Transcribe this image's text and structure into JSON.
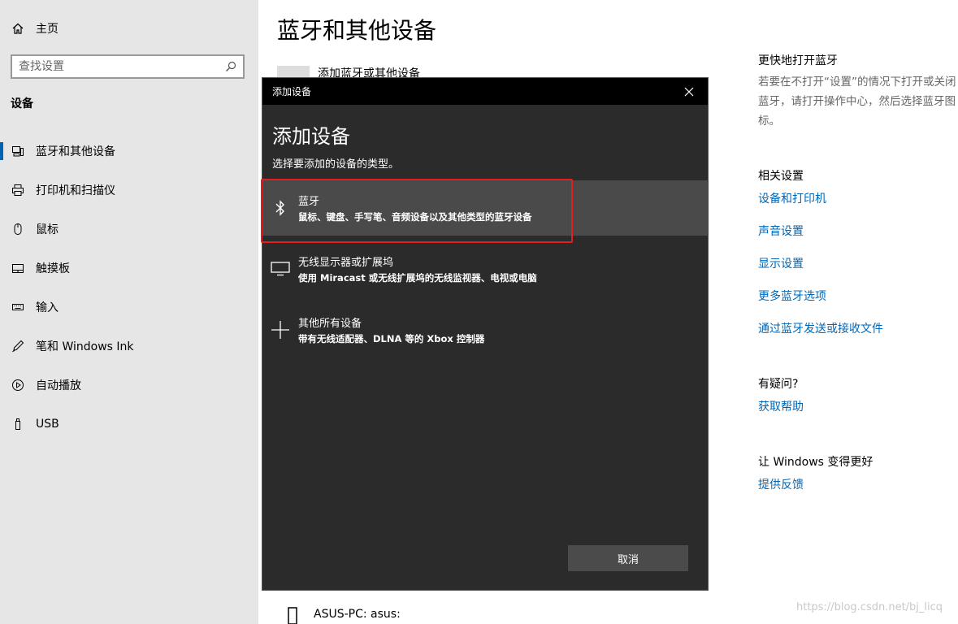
{
  "sidebar": {
    "home_label": "主页",
    "search_placeholder": "查找设置",
    "section_label": "设备",
    "items": [
      {
        "label": "蓝牙和其他设备",
        "icon": "bluetooth-devices-icon"
      },
      {
        "label": "打印机和扫描仪",
        "icon": "printer-icon"
      },
      {
        "label": "鼠标",
        "icon": "mouse-icon"
      },
      {
        "label": "触摸板",
        "icon": "touchpad-icon"
      },
      {
        "label": "输入",
        "icon": "keyboard-icon"
      },
      {
        "label": "笔和 Windows Ink",
        "icon": "pen-icon"
      },
      {
        "label": "自动播放",
        "icon": "autoplay-icon"
      },
      {
        "label": "USB",
        "icon": "usb-icon"
      }
    ]
  },
  "main": {
    "title": "蓝牙和其他设备",
    "add_device_label": "添加蓝牙或其他设备",
    "device_name": "ASUS-PC: asus:"
  },
  "right": {
    "quick_title": "更快地打开蓝牙",
    "quick_desc": "若要在不打开“设置”的情况下打开或关闭蓝牙，请打开操作中心，然后选择蓝牙图标。",
    "related_title": "相关设置",
    "links": [
      "设备和打印机",
      "声音设置",
      "显示设置",
      "更多蓝牙选项",
      "通过蓝牙发送或接收文件"
    ],
    "question_title": "有疑问?",
    "help_link": "获取帮助",
    "better_title": "让 Windows 变得更好",
    "feedback_link": "提供反馈"
  },
  "dialog": {
    "window_title": "添加设备",
    "heading": "添加设备",
    "subtitle": "选择要添加的设备的类型。",
    "options": [
      {
        "name": "蓝牙",
        "desc": "鼠标、键盘、手写笔、音频设备以及其他类型的蓝牙设备",
        "icon": "bluetooth-icon"
      },
      {
        "name": "无线显示器或扩展坞",
        "desc": "使用 Miracast 或无线扩展坞的无线监视器、电视或电脑",
        "icon": "monitor-icon"
      },
      {
        "name": "其他所有设备",
        "desc": "带有无线适配器、DLNA 等的 Xbox 控制器",
        "icon": "plus-icon"
      }
    ],
    "cancel_label": "取消"
  },
  "watermark": "https://blog.csdn.net/bj_licq",
  "colors": {
    "accent": "#0063b1",
    "link": "#0067b8",
    "highlight": "#e02020",
    "dialog_bg": "#2b2b2b"
  }
}
